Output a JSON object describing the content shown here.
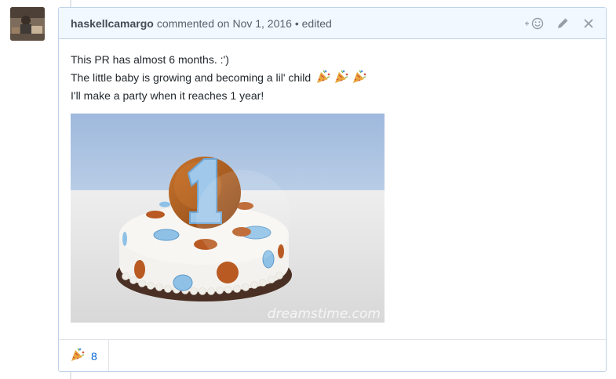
{
  "comment": {
    "author": "haskellcamargo",
    "action_text": "commented on",
    "date": "Nov 1, 2016",
    "separator": " • ",
    "edited_label": "edited",
    "body_lines": [
      "This PR has almost 6 months. :')",
      "The little baby is growing and becoming a lil' child",
      "I'll make a party when it reaches 1 year!"
    ],
    "inline_emoji": "tada",
    "inline_emoji_count": 3,
    "image_watermark": "dreamstime.com"
  },
  "header_actions": {
    "add_reaction_icon": "add-reaction-icon",
    "edit_icon": "pencil-icon",
    "delete_icon": "close-icon"
  },
  "reactions": [
    {
      "emoji": "tada",
      "count": "8"
    }
  ],
  "colors": {
    "header_bg": "#f1f8ff",
    "border": "#c0d3eb",
    "link": "#0366d6",
    "muted": "#586069"
  }
}
